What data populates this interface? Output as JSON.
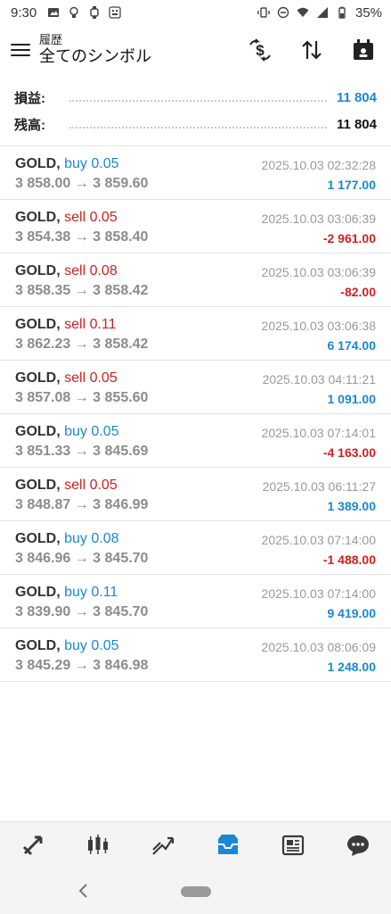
{
  "status_bar": {
    "time": "9:30",
    "battery": "35%"
  },
  "header": {
    "subtitle": "履歴",
    "title": "全てのシンボル"
  },
  "summary": {
    "profit_label": "損益:",
    "profit_value": "11 804",
    "balance_label": "残高:",
    "balance_value": "11 804"
  },
  "trades": [
    {
      "symbol": "GOLD,",
      "side": "buy",
      "volume": "0.05",
      "open": "3 858.00",
      "close": "3 859.60",
      "time": "2025.10.03 02:32:28",
      "profit": "1 177.00"
    },
    {
      "symbol": "GOLD,",
      "side": "sell",
      "volume": "0.05",
      "open": "3 854.38",
      "close": "3 858.40",
      "time": "2025.10.03 03:06:39",
      "profit": "-2 961.00"
    },
    {
      "symbol": "GOLD,",
      "side": "sell",
      "volume": "0.08",
      "open": "3 858.35",
      "close": "3 858.42",
      "time": "2025.10.03 03:06:39",
      "profit": "-82.00"
    },
    {
      "symbol": "GOLD,",
      "side": "sell",
      "volume": "0.11",
      "open": "3 862.23",
      "close": "3 858.42",
      "time": "2025.10.03 03:06:38",
      "profit": "6 174.00"
    },
    {
      "symbol": "GOLD,",
      "side": "sell",
      "volume": "0.05",
      "open": "3 857.08",
      "close": "3 855.60",
      "time": "2025.10.03 04:11:21",
      "profit": "1 091.00"
    },
    {
      "symbol": "GOLD,",
      "side": "buy",
      "volume": "0.05",
      "open": "3 851.33",
      "close": "3 845.69",
      "time": "2025.10.03 07:14:01",
      "profit": "-4 163.00"
    },
    {
      "symbol": "GOLD,",
      "side": "sell",
      "volume": "0.05",
      "open": "3 848.87",
      "close": "3 846.99",
      "time": "2025.10.03 06:11:27",
      "profit": "1 389.00"
    },
    {
      "symbol": "GOLD,",
      "side": "buy",
      "volume": "0.08",
      "open": "3 846.96",
      "close": "3 845.70",
      "time": "2025.10.03 07:14:00",
      "profit": "-1 488.00"
    },
    {
      "symbol": "GOLD,",
      "side": "buy",
      "volume": "0.11",
      "open": "3 839.90",
      "close": "3 845.70",
      "time": "2025.10.03 07:14:00",
      "profit": "9 419.00"
    },
    {
      "symbol": "GOLD,",
      "side": "buy",
      "volume": "0.05",
      "open": "3 845.29",
      "close": "3 846.98",
      "time": "2025.10.03 08:06:09",
      "profit": "1 248.00"
    }
  ],
  "bottom_nav": {
    "items": [
      {
        "icon": "quotes-icon",
        "active": false
      },
      {
        "icon": "chart-icon",
        "active": false
      },
      {
        "icon": "trade-icon",
        "active": false
      },
      {
        "icon": "history-icon",
        "active": true
      },
      {
        "icon": "news-icon",
        "active": false
      },
      {
        "icon": "chat-icon",
        "active": false
      }
    ]
  },
  "colors": {
    "accent": "#1a87d7",
    "loss": "#d21f1f",
    "muted": "#8c8c8c"
  }
}
